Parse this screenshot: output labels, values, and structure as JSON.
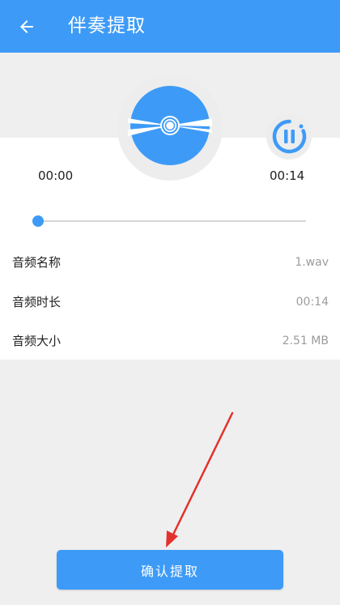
{
  "header": {
    "title": "伴奏提取",
    "back_icon": "arrow-left-icon"
  },
  "player": {
    "current_time": "00:00",
    "total_time": "00:14",
    "progress": 0.0,
    "state": "playing",
    "disc_icon": "disc-icon",
    "control_icon": "pause-icon"
  },
  "info": [
    {
      "label": "音频名称",
      "value": "1.wav"
    },
    {
      "label": "音频时长",
      "value": "00:14"
    },
    {
      "label": "音频大小",
      "value": "2.51 MB"
    }
  ],
  "footer": {
    "confirm_label": "确认提取"
  },
  "colors": {
    "accent": "#3d9bf7",
    "annotation_arrow": "#e3312b",
    "background": "#efefef"
  }
}
